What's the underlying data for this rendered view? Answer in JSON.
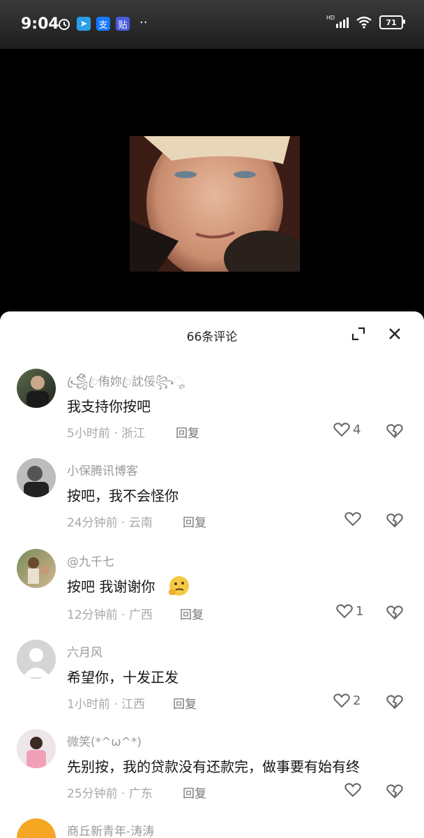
{
  "status": {
    "time": "9:04",
    "signal_label": "HD",
    "battery": "71"
  },
  "sheet": {
    "title": "66条评论"
  },
  "comments": [
    {
      "username": "꧁ꦿꦼꦿ侑妳ꦿ訦俀꧂ೄ",
      "text": "我支持你按吧",
      "time": "5小时前",
      "location": "浙江",
      "reply": "回复",
      "likes": "4"
    },
    {
      "username": "小保腾讯博客",
      "text": "按吧，我不会怪你",
      "time": "24分钟前",
      "location": "云南",
      "reply": "回复",
      "likes": ""
    },
    {
      "username": "@九千七",
      "text": "按吧 我谢谢你",
      "time": "12分钟前",
      "location": "广西",
      "reply": "回复",
      "likes": "1"
    },
    {
      "username": "六月风",
      "text": "希望你，十发正发",
      "time": "1小时前",
      "location": "江西",
      "reply": "回复",
      "likes": "2"
    },
    {
      "username": "微笑(*^ω^*)",
      "text": "先别按，我的贷款没有还款完，做事要有始有终",
      "time": "25分钟前",
      "location": "广东",
      "reply": "回复",
      "likes": ""
    },
    {
      "username": "商丘新青年-涛涛"
    }
  ],
  "meta_separator": "·"
}
